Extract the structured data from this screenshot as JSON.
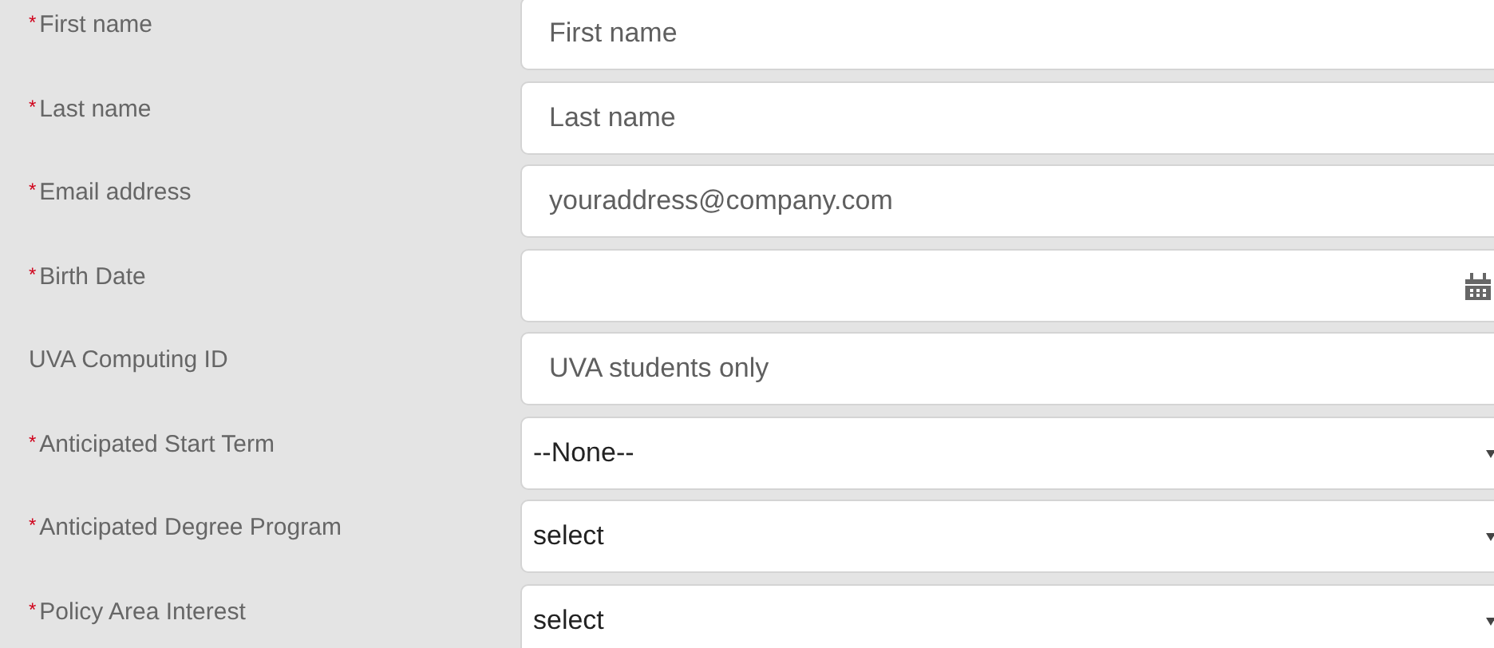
{
  "fields": [
    {
      "mark": "*",
      "label": "First name",
      "kind": "text",
      "placeholder": "First name"
    },
    {
      "mark": "*",
      "label": "Last name",
      "kind": "text",
      "placeholder": "Last name"
    },
    {
      "mark": "*",
      "label": "Email address",
      "kind": "text",
      "placeholder": "youraddress@company.com"
    },
    {
      "mark": "*",
      "label": "Birth Date",
      "kind": "date"
    },
    {
      "label": "UVA Computing ID",
      "kind": "text",
      "placeholder": "UVA students only"
    },
    {
      "mark": "*",
      "label": "Anticipated Start Term",
      "kind": "select",
      "value": "--None--"
    },
    {
      "mark": "*",
      "label": "Anticipated Degree Program",
      "kind": "select",
      "value": "select"
    },
    {
      "mark": "*",
      "label": "Policy Area Interest",
      "kind": "select",
      "value": "select"
    }
  ]
}
